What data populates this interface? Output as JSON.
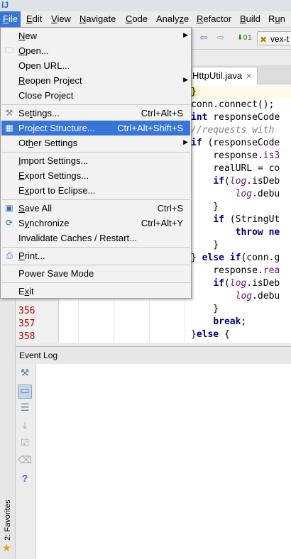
{
  "menubar": {
    "items": [
      {
        "label": "File",
        "mnemonic": "F"
      },
      {
        "label": "Edit",
        "mnemonic": "E"
      },
      {
        "label": "View",
        "mnemonic": "V"
      },
      {
        "label": "Navigate",
        "mnemonic": "N"
      },
      {
        "label": "Code",
        "mnemonic": "C"
      },
      {
        "label": "Analyze",
        "mnemonic": "z"
      },
      {
        "label": "Refactor",
        "mnemonic": "R"
      },
      {
        "label": "Build",
        "mnemonic": "B"
      },
      {
        "label": "Run",
        "mnemonic": "u"
      }
    ]
  },
  "toolbar": {
    "run_config": "vex-t"
  },
  "editor": {
    "tab_label": "HttpUtil.java",
    "tab_close": "×",
    "line_numbers": [
      "356",
      "357",
      "358"
    ],
    "code_lines": [
      {
        "parts": [
          {
            "t": "}",
            "c": "brace-hl"
          }
        ]
      },
      {
        "parts": [
          {
            "t": "conn.connect();"
          }
        ]
      },
      {
        "parts": [
          {
            "t": "int",
            "c": "kw"
          },
          {
            "t": " responseCode"
          }
        ]
      },
      {
        "parts": [
          {
            "t": "//requests with",
            "c": "cm"
          }
        ]
      },
      {
        "parts": [
          {
            "t": "if",
            "c": "kw"
          },
          {
            "t": " (responseCode"
          }
        ]
      },
      {
        "parts": [
          {
            "t": "    response."
          },
          {
            "t": "is3",
            "c": "mth"
          }
        ]
      },
      {
        "parts": [
          {
            "t": "    realURL = co"
          }
        ]
      },
      {
        "parts": [
          {
            "t": "    "
          },
          {
            "t": "if",
            "c": "kw"
          },
          {
            "t": "("
          },
          {
            "t": "log",
            "c": "fld"
          },
          {
            "t": ".isDeb"
          }
        ]
      },
      {
        "parts": [
          {
            "t": "        "
          },
          {
            "t": "log",
            "c": "fld"
          },
          {
            "t": ".debu"
          }
        ]
      },
      {
        "parts": [
          {
            "t": "    }"
          }
        ]
      },
      {
        "parts": [
          {
            "t": "    "
          },
          {
            "t": "if",
            "c": "kw"
          },
          {
            "t": " (StringUt"
          }
        ]
      },
      {
        "parts": [
          {
            "t": "        "
          },
          {
            "t": "throw ne",
            "c": "kw"
          }
        ]
      },
      {
        "parts": [
          {
            "t": "    }"
          }
        ]
      },
      {
        "parts": [
          {
            "t": "} "
          },
          {
            "t": "else if",
            "c": "kw"
          },
          {
            "t": "(conn.g"
          }
        ]
      },
      {
        "parts": [
          {
            "t": "    response."
          },
          {
            "t": "rea",
            "c": "mth"
          }
        ]
      },
      {
        "parts": [
          {
            "t": "    "
          },
          {
            "t": "if",
            "c": "kw"
          },
          {
            "t": "("
          },
          {
            "t": "log",
            "c": "fld"
          },
          {
            "t": ".isDeb"
          }
        ]
      },
      {
        "parts": [
          {
            "t": "        "
          },
          {
            "t": "log",
            "c": "fld"
          },
          {
            "t": ".debu"
          }
        ]
      },
      {
        "parts": [
          {
            "t": "    }"
          }
        ]
      },
      {
        "parts": [
          {
            "t": "    "
          },
          {
            "t": "break",
            "c": "kw"
          },
          {
            "t": ";"
          }
        ]
      },
      {
        "parts": [
          {
            "t": "}"
          },
          {
            "t": "else",
            "c": "kw"
          },
          {
            "t": " {"
          }
        ]
      }
    ]
  },
  "file_menu": {
    "items": [
      {
        "type": "item",
        "label": "New",
        "mnemonic": "N",
        "submenu": true,
        "name": "menu-item-new"
      },
      {
        "type": "item",
        "label": "Open...",
        "mnemonic": "O",
        "icon": "folder-icon",
        "name": "menu-item-open"
      },
      {
        "type": "item",
        "label": "Open URL...",
        "mnemonic": "",
        "name": "menu-item-open-url"
      },
      {
        "type": "item",
        "label": "Reopen Project",
        "mnemonic": "R",
        "submenu": true,
        "name": "menu-item-reopen-project"
      },
      {
        "type": "item",
        "label": "Close Project",
        "mnemonic": "j",
        "name": "menu-item-close-project"
      },
      {
        "type": "separator"
      },
      {
        "type": "item",
        "label": "Settings...",
        "mnemonic": "t",
        "shortcut": "Ctrl+Alt+S",
        "icon": "wrench-icon",
        "name": "menu-item-settings"
      },
      {
        "type": "item",
        "label": "Project Structure...",
        "mnemonic": "",
        "shortcut": "Ctrl+Alt+Shift+S",
        "icon": "project-structure-icon",
        "selected": true,
        "name": "menu-item-project-structure"
      },
      {
        "type": "item",
        "label": "Other Settings",
        "mnemonic": "h",
        "submenu": true,
        "name": "menu-item-other-settings"
      },
      {
        "type": "separator"
      },
      {
        "type": "item",
        "label": "Import Settings...",
        "mnemonic": "I",
        "name": "menu-item-import-settings"
      },
      {
        "type": "item",
        "label": "Export Settings...",
        "mnemonic": "E",
        "name": "menu-item-export-settings"
      },
      {
        "type": "item",
        "label": "Export to Eclipse...",
        "mnemonic": "x",
        "name": "menu-item-export-to-eclipse"
      },
      {
        "type": "separator"
      },
      {
        "type": "item",
        "label": "Save All",
        "mnemonic": "S",
        "shortcut": "Ctrl+S",
        "icon": "save-icon",
        "name": "menu-item-save-all"
      },
      {
        "type": "item",
        "label": "Synchronize",
        "mnemonic": "y",
        "shortcut": "Ctrl+Alt+Y",
        "icon": "sync-icon",
        "name": "menu-item-synchronize"
      },
      {
        "type": "item",
        "label": "Invalidate Caches / Restart...",
        "mnemonic": "",
        "name": "menu-item-invalidate-caches"
      },
      {
        "type": "separator"
      },
      {
        "type": "item",
        "label": "Print...",
        "mnemonic": "P",
        "icon": "print-icon",
        "name": "menu-item-print"
      },
      {
        "type": "separator"
      },
      {
        "type": "item",
        "label": "Power Save Mode",
        "mnemonic": "",
        "name": "menu-item-power-save-mode"
      },
      {
        "type": "separator"
      },
      {
        "type": "item",
        "label": "Exit",
        "mnemonic": "x",
        "name": "menu-item-exit"
      }
    ]
  },
  "event_log": {
    "title": "Event Log",
    "tool_icons": [
      "wrench-icon",
      "message-bubble-icon",
      "filter-settings-icon",
      "scroll-to-end-icon",
      "mark-read-icon",
      "trash-icon",
      "help-icon"
    ]
  },
  "left_strip": {
    "favorites_label": "2: Favorites"
  },
  "colors": {
    "selection": "#3875d7",
    "line_number": "#b00000",
    "keyword": "#000080"
  }
}
